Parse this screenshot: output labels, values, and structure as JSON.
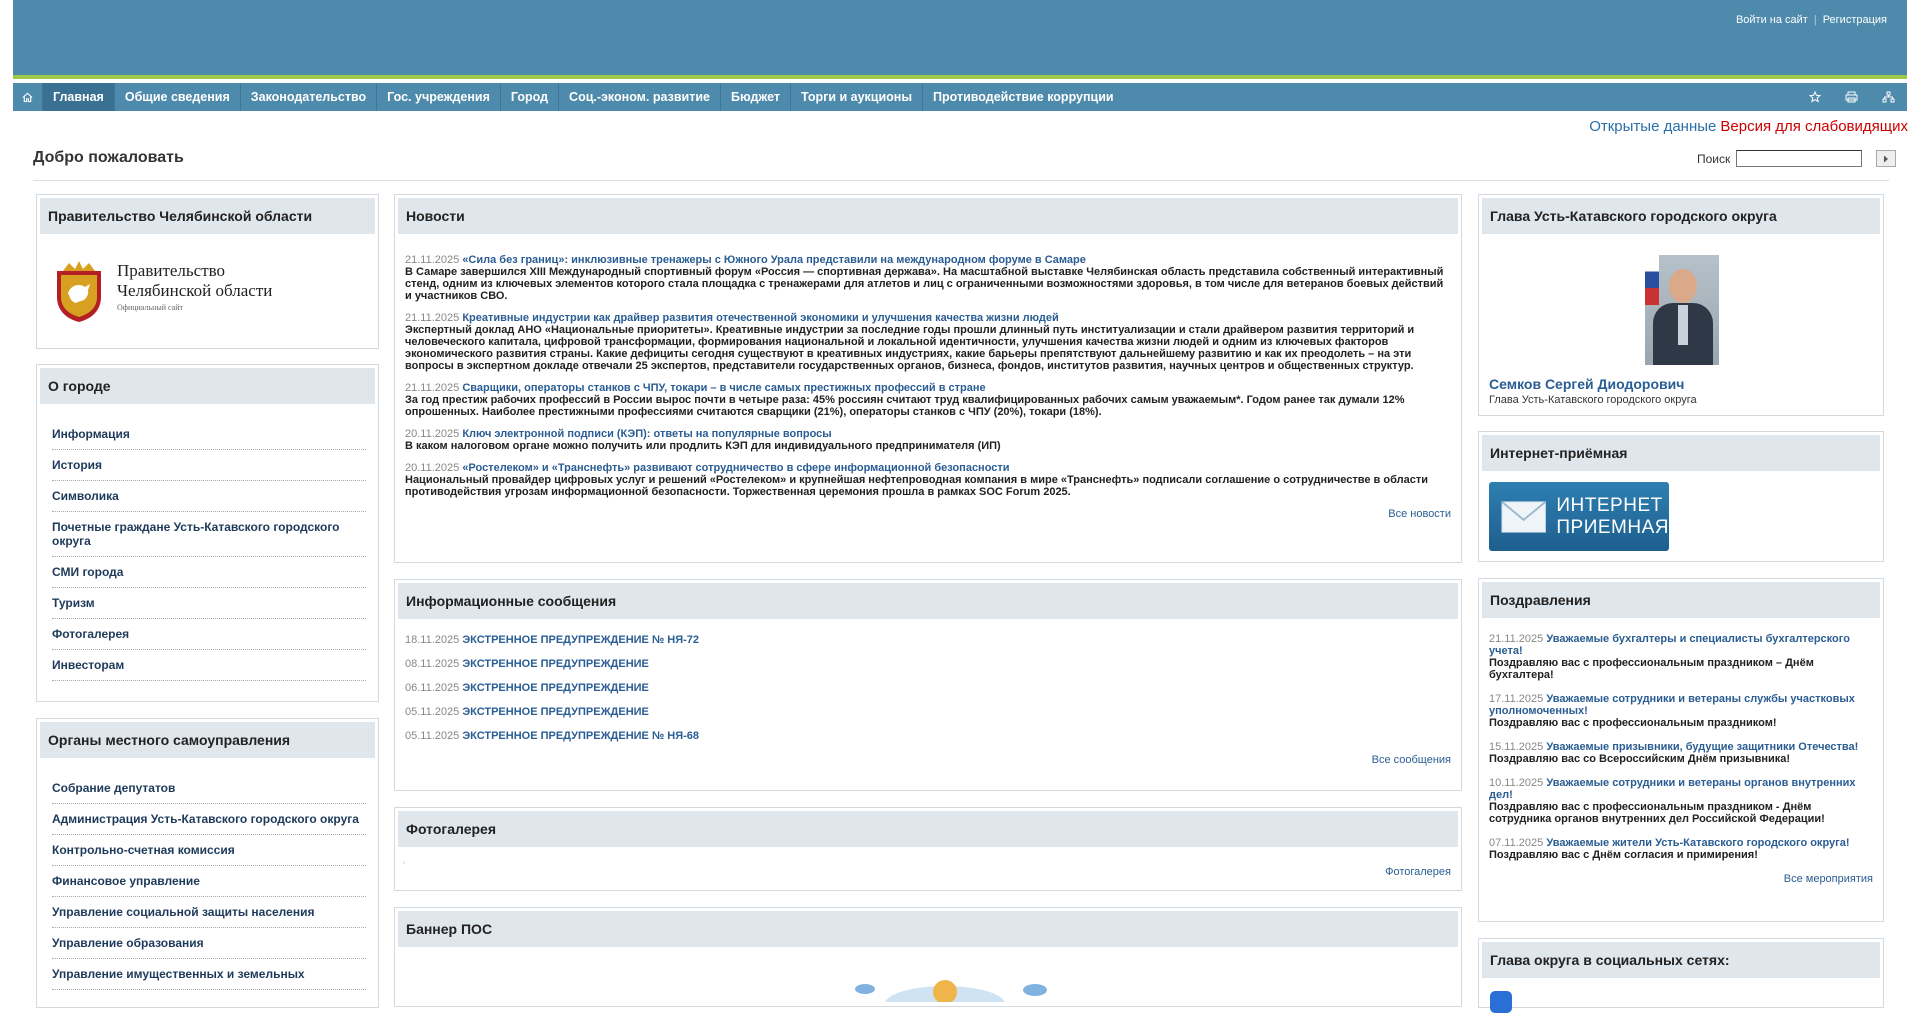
{
  "header": {
    "login": "Войти на сайт",
    "register": "Регистрация"
  },
  "nav": {
    "home_icon": "home-icon",
    "items": [
      {
        "label": "Главная",
        "active": true
      },
      {
        "label": "Общие сведения"
      },
      {
        "label": "Законодательство"
      },
      {
        "label": "Гос. учреждения"
      },
      {
        "label": "Город"
      },
      {
        "label": "Соц.-эконом. развитие"
      },
      {
        "label": "Бюджет"
      },
      {
        "label": "Торги и аукционы"
      },
      {
        "label": "Противодействие коррупции"
      }
    ],
    "tools": [
      "star-icon",
      "print-icon",
      "sitemap-icon"
    ]
  },
  "top_links": {
    "open_data": "Открытые данные",
    "visually_impaired": "Версия для слабовидящих"
  },
  "welcome": "Добро пожаловать",
  "search": {
    "label": "Поиск",
    "value": ""
  },
  "gov_box": {
    "title": "Правительство Челябинской области",
    "logo_line1": "Правительство",
    "logo_line2": "Челябинской области",
    "logo_sub": "Официальный сайт"
  },
  "city_box": {
    "title": "О городе",
    "items": [
      "Информация",
      "История",
      "Символика",
      "Почетные граждане Усть-Катавского городского округа",
      "СМИ города",
      "Туризм",
      "Фотогалерея",
      "Инвесторам"
    ]
  },
  "organs_box": {
    "title": "Органы местного самоуправления",
    "items": [
      "Собрание депутатов",
      "Администрация Усть-Катавского городского округа",
      "Контрольно-счетная комиссия",
      "Финансовое управление",
      "Управление социальной защиты населения",
      "Управление образования",
      "Управление имущественных и земельных"
    ]
  },
  "news_box": {
    "title": "Новости",
    "items": [
      {
        "date": "21.11.2025",
        "title": "«Сила без границ»: инклюзивные тренажеры с Южного Урала представили на международном форуме в Самаре",
        "summary": "В Самаре завершился XIII Международный спортивный форум «Россия — спортивная держава». На масштабной выставке Челябинская область представила собственный интерактивный стенд, одним из ключевых элементов которого стала площадка с тренажерами для атлетов и лиц с ограниченными возможностями здоровья, в том числе для ветеранов боевых действий и участников СВО."
      },
      {
        "date": "21.11.2025",
        "title": "Креативные индустрии как драйвер развития отечественной экономики и улучшения качества жизни людей",
        "summary": "Экспертный доклад АНО «Национальные приоритеты».  Креативные индустрии за последние годы прошли длинный путь институализации и стали драйвером развития территорий и человеческого капитала, цифровой трансформации, формирования национальной и локальной идентичности, улучшения качества жизни людей и одним из ключевых факторов экономического развития страны. Какие дефициты сегодня существуют в креативных индустриях, какие барьеры препятствуют дальнейшему развитию и как их преодолеть – на эти вопросы в экспертном докладе отвечали 25 экспертов, представители государственных органов, бизнеса, фондов, институтов развития, научных центров и общественных структур."
      },
      {
        "date": "21.11.2025",
        "title": "Сварщики, операторы станков с ЧПУ, токари – в числе самых престижных профессий в стране",
        "summary": "За год престиж рабочих профессий в России вырос почти в четыре раза: 45% россиян считают труд квалифицированных рабочих самым уважаемым*. Годом ранее так думали 12% опрошенных. Наиболее престижными профессиями считаются сварщики (21%), операторы станков с ЧПУ (20%), токари (18%)."
      },
      {
        "date": "20.11.2025",
        "title": "Ключ электронной подписи (КЭП): ответы на популярные вопросы",
        "summary": "В каком налоговом органе можно получить или продлить КЭП для индивидуального предпринимателя (ИП)"
      },
      {
        "date": "20.11.2025",
        "title": "«Ростелеком» и «Транснефть» развивают сотрудничество в сфере информационной безопасности",
        "summary": "Национальный провайдер цифровых услуг и решений «Ростелеком» и крупнейшая нефтепроводная компания в мире «Транснефть» подписали соглашение о сотрудничестве в области противодействия угрозам информационной безопасности. Торжественная церемония прошла в рамках SOC Forum 2025."
      }
    ],
    "all": "Все новости"
  },
  "messages_box": {
    "title": "Информационные сообщения",
    "items": [
      {
        "date": "18.11.2025",
        "title": "ЭКСТРЕННОЕ ПРЕДУПРЕЖДЕНИЕ № НЯ-72"
      },
      {
        "date": "08.11.2025",
        "title": "ЭКСТРЕННОЕ ПРЕДУПРЕЖДЕНИЕ"
      },
      {
        "date": "06.11.2025",
        "title": "ЭКСТРЕННОЕ ПРЕДУПРЕЖДЕНИЕ"
      },
      {
        "date": "05.11.2025",
        "title": "ЭКСТРЕННОЕ ПРЕДУПРЕЖДЕНИЕ"
      },
      {
        "date": "05.11.2025",
        "title": "ЭКСТРЕННОЕ ПРЕДУПРЕЖДЕНИЕ № НЯ-68"
      }
    ],
    "all": "Все сообщения"
  },
  "gallery_box": {
    "title": "Фотогалерея",
    "link": "Фотогалерея"
  },
  "banner_box": {
    "title": "Баннер ПОС"
  },
  "head_box": {
    "title": "Глава Усть-Катавского городского округа",
    "name": "Семков Сергей Диодорович",
    "position": "Глава Усть-Катавского городского округа"
  },
  "reception_box": {
    "title": "Интернет-приёмная",
    "banner_line1": "ИНТЕРНЕТ",
    "banner_line2": "ПРИЕМНАЯ"
  },
  "congrats_box": {
    "title": "Поздравления",
    "items": [
      {
        "date": "21.11.2025",
        "title": "Уважаемые бухгалтеры и специалисты бухгалтерского учета!",
        "summary": "Поздравляю вас с профессиональным праздником – Днём бухгалтера!"
      },
      {
        "date": "17.11.2025",
        "title": "Уважаемые сотрудники и ветераны службы участковых уполномоченных!",
        "summary": "Поздравляю вас с профессиональным праздником!"
      },
      {
        "date": "15.11.2025",
        "title": "Уважаемые призывники, будущие защитники Отечества!",
        "summary": "Поздравляю вас со Всероссийским Днём призывника!"
      },
      {
        "date": "10.11.2025",
        "title": "Уважаемые сотрудники и ветераны органов внутренних дел!",
        "summary": "Поздравляю вас с профессиональным праздником - Днём сотрудника органов внутренних дел Российской Федерации!"
      },
      {
        "date": "07.11.2025",
        "title": "Уважаемые жители Усть-Катавского городского округа!",
        "summary": "Поздравляю вас с Днём согласия и примирения!"
      }
    ],
    "all": "Все мероприятия"
  },
  "social_box": {
    "title": "Глава округа в социальных сетях:"
  }
}
